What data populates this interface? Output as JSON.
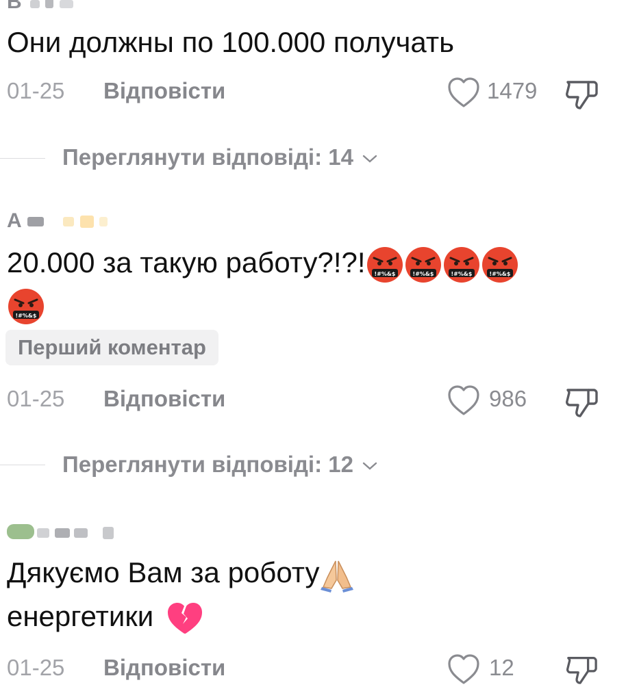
{
  "comments": [
    {
      "username": "В",
      "text": "Они должны по 100.000 получать",
      "date": "01-25",
      "reply_label": "Відповісти",
      "likes": "1479",
      "view_replies": "Переглянути відповіді: 14"
    },
    {
      "username": "А",
      "text": "20.000 за такую работу?!?!",
      "badge": "Перший коментар",
      "date": "01-25",
      "reply_label": "Відповісти",
      "likes": "986",
      "view_replies": "Переглянути відповіді: 12"
    },
    {
      "username": "",
      "text_line1": "Дякуємо Вам за роботу",
      "text_line2": "енергетики",
      "date": "01-25",
      "reply_label": "Відповісти",
      "likes": "12"
    }
  ],
  "icons": {
    "like": "heart-outline-icon",
    "dislike": "thumbs-down-icon",
    "expand": "chevron-down-icon",
    "angry_emoji": "face-with-symbols-on-mouth-emoji",
    "pray_emoji": "folded-hands-emoji",
    "broken_heart_emoji": "broken-heart-emoji"
  },
  "colors": {
    "text": "#111111",
    "meta": "#8a8b90",
    "angry": "#e8442e",
    "broken_heart": "#ff3f80"
  }
}
